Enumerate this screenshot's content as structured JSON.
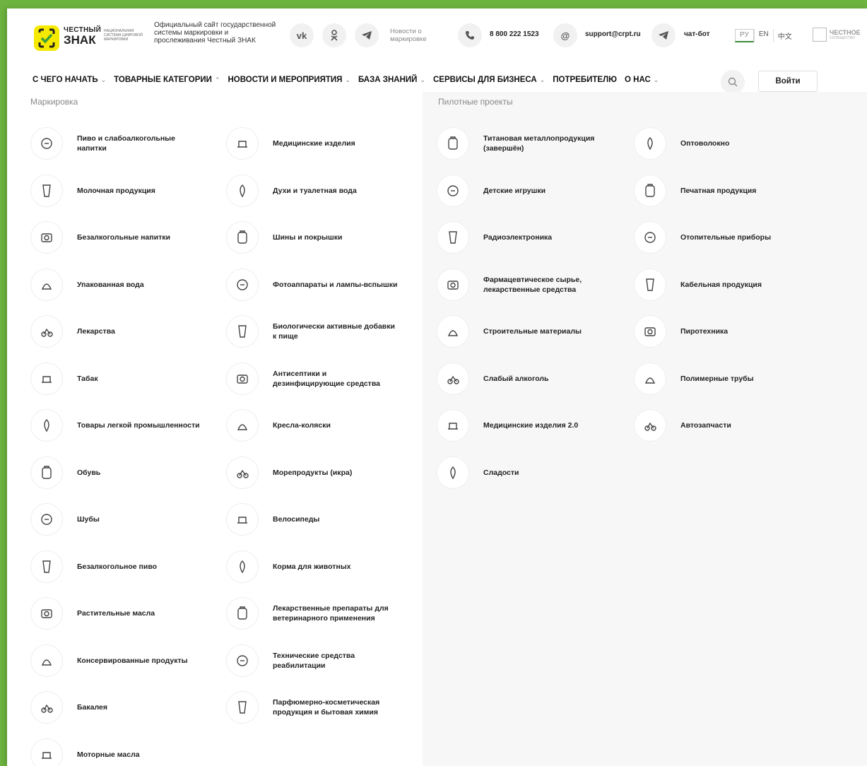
{
  "header": {
    "logo_line1": "ЧЕСТНЫЙ",
    "logo_line2": "ЗНАК",
    "logo_sub": "НАЦИОНАЛЬНАЯ СИСТЕМА ЦИФРОВОЙ МАРКИРОВКИ",
    "site_description": "Официальный сайт государственной системы маркировки и прослеживания Честный ЗНАК",
    "news_label": "Новости о маркировке",
    "phone": "8 800 222 1523",
    "email": "support@crpt.ru",
    "chatbot": "чат-бот",
    "languages": [
      "РУ",
      "EN",
      "中文"
    ],
    "community_title": "ЧЕСТНОЕ",
    "community_sub": "СООБЩЕСТВО",
    "icons": [
      "vk-icon",
      "odnoklassniki-icon",
      "telegram-icon",
      "phone-icon",
      "at-icon",
      "telegram-chat-icon"
    ]
  },
  "nav": {
    "items": [
      {
        "label": "С ЧЕГО НАЧАТЬ",
        "chevron": "⌄"
      },
      {
        "label": "ТОВАРНЫЕ КАТЕГОРИИ",
        "chevron": "⌃"
      },
      {
        "label": "НОВОСТИ И МЕРОПРИЯТИЯ",
        "chevron": "⌄"
      },
      {
        "label": "БАЗА ЗНАНИЙ",
        "chevron": "⌄"
      },
      {
        "label": "СЕРВИСЫ ДЛЯ БИЗНЕСА",
        "chevron": "⌄"
      },
      {
        "label": "ПОТРЕБИТЕЛЮ",
        "chevron": ""
      },
      {
        "label": "О НАС",
        "chevron": "⌄"
      }
    ],
    "login_label": "Войти"
  },
  "dropdown": {
    "marking_title": "Маркировка",
    "pilot_title": "Пилотные проекты",
    "marking_col1": [
      "Пиво и слабоалкогольные напитки",
      "Молочная продукция",
      "Безалкогольные напитки",
      "Упакованная вода",
      "Лекарства",
      "Табак",
      "Товары легкой промышленности",
      "Обувь",
      "Шубы",
      "Безалкогольное пиво",
      "Растительные масла",
      "Консервированные продукты",
      "Бакалея",
      "Моторные масла"
    ],
    "marking_col2": [
      "Медицинские изделия",
      "Духи и туалетная вода",
      "Шины и покрышки",
      "Фотоаппараты и лампы-вспышки",
      "Биологически активные добавки к пище",
      "Антисептики и дезинфицирующие средства",
      "Кресла-коляски",
      "Морепродукты (икра)",
      "Велосипеды",
      "Корма для животных",
      "Лекарственные препараты для ветеринарного применения",
      "Технические средства реабилитации",
      "Парфюмерно-косметическая продукция и бытовая химия"
    ],
    "pilot_col1": [
      "Титановая металлопродукция (завершён)",
      "Детские игрушки",
      "Радиоэлектроника",
      "Фармацевтическое сырье, лекарственные средства",
      "Строительные материалы",
      "Слабый алкоголь",
      "Медицинские изделия 2.0",
      "Сладости"
    ],
    "pilot_col2": [
      "Оптоволокно",
      "Печатная продукция",
      "Отопительные приборы",
      "Кабельная продукция",
      "Пиротехника",
      "Полимерные трубы",
      "Автозапчасти"
    ]
  }
}
